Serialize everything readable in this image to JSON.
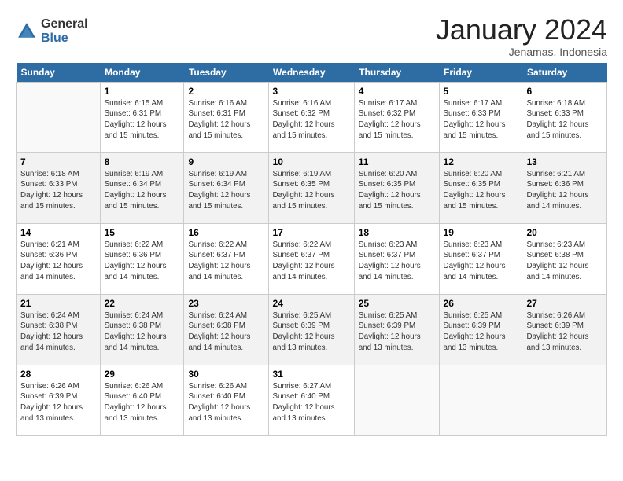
{
  "logo": {
    "general": "General",
    "blue": "Blue"
  },
  "title": "January 2024",
  "subtitle": "Jenamas, Indonesia",
  "header_days": [
    "Sunday",
    "Monday",
    "Tuesday",
    "Wednesday",
    "Thursday",
    "Friday",
    "Saturday"
  ],
  "weeks": [
    [
      {
        "num": "",
        "info": ""
      },
      {
        "num": "1",
        "info": "Sunrise: 6:15 AM\nSunset: 6:31 PM\nDaylight: 12 hours\nand 15 minutes."
      },
      {
        "num": "2",
        "info": "Sunrise: 6:16 AM\nSunset: 6:31 PM\nDaylight: 12 hours\nand 15 minutes."
      },
      {
        "num": "3",
        "info": "Sunrise: 6:16 AM\nSunset: 6:32 PM\nDaylight: 12 hours\nand 15 minutes."
      },
      {
        "num": "4",
        "info": "Sunrise: 6:17 AM\nSunset: 6:32 PM\nDaylight: 12 hours\nand 15 minutes."
      },
      {
        "num": "5",
        "info": "Sunrise: 6:17 AM\nSunset: 6:33 PM\nDaylight: 12 hours\nand 15 minutes."
      },
      {
        "num": "6",
        "info": "Sunrise: 6:18 AM\nSunset: 6:33 PM\nDaylight: 12 hours\nand 15 minutes."
      }
    ],
    [
      {
        "num": "7",
        "info": "Sunrise: 6:18 AM\nSunset: 6:33 PM\nDaylight: 12 hours\nand 15 minutes."
      },
      {
        "num": "8",
        "info": "Sunrise: 6:19 AM\nSunset: 6:34 PM\nDaylight: 12 hours\nand 15 minutes."
      },
      {
        "num": "9",
        "info": "Sunrise: 6:19 AM\nSunset: 6:34 PM\nDaylight: 12 hours\nand 15 minutes."
      },
      {
        "num": "10",
        "info": "Sunrise: 6:19 AM\nSunset: 6:35 PM\nDaylight: 12 hours\nand 15 minutes."
      },
      {
        "num": "11",
        "info": "Sunrise: 6:20 AM\nSunset: 6:35 PM\nDaylight: 12 hours\nand 15 minutes."
      },
      {
        "num": "12",
        "info": "Sunrise: 6:20 AM\nSunset: 6:35 PM\nDaylight: 12 hours\nand 15 minutes."
      },
      {
        "num": "13",
        "info": "Sunrise: 6:21 AM\nSunset: 6:36 PM\nDaylight: 12 hours\nand 14 minutes."
      }
    ],
    [
      {
        "num": "14",
        "info": "Sunrise: 6:21 AM\nSunset: 6:36 PM\nDaylight: 12 hours\nand 14 minutes."
      },
      {
        "num": "15",
        "info": "Sunrise: 6:22 AM\nSunset: 6:36 PM\nDaylight: 12 hours\nand 14 minutes."
      },
      {
        "num": "16",
        "info": "Sunrise: 6:22 AM\nSunset: 6:37 PM\nDaylight: 12 hours\nand 14 minutes."
      },
      {
        "num": "17",
        "info": "Sunrise: 6:22 AM\nSunset: 6:37 PM\nDaylight: 12 hours\nand 14 minutes."
      },
      {
        "num": "18",
        "info": "Sunrise: 6:23 AM\nSunset: 6:37 PM\nDaylight: 12 hours\nand 14 minutes."
      },
      {
        "num": "19",
        "info": "Sunrise: 6:23 AM\nSunset: 6:37 PM\nDaylight: 12 hours\nand 14 minutes."
      },
      {
        "num": "20",
        "info": "Sunrise: 6:23 AM\nSunset: 6:38 PM\nDaylight: 12 hours\nand 14 minutes."
      }
    ],
    [
      {
        "num": "21",
        "info": "Sunrise: 6:24 AM\nSunset: 6:38 PM\nDaylight: 12 hours\nand 14 minutes."
      },
      {
        "num": "22",
        "info": "Sunrise: 6:24 AM\nSunset: 6:38 PM\nDaylight: 12 hours\nand 14 minutes."
      },
      {
        "num": "23",
        "info": "Sunrise: 6:24 AM\nSunset: 6:38 PM\nDaylight: 12 hours\nand 14 minutes."
      },
      {
        "num": "24",
        "info": "Sunrise: 6:25 AM\nSunset: 6:39 PM\nDaylight: 12 hours\nand 13 minutes."
      },
      {
        "num": "25",
        "info": "Sunrise: 6:25 AM\nSunset: 6:39 PM\nDaylight: 12 hours\nand 13 minutes."
      },
      {
        "num": "26",
        "info": "Sunrise: 6:25 AM\nSunset: 6:39 PM\nDaylight: 12 hours\nand 13 minutes."
      },
      {
        "num": "27",
        "info": "Sunrise: 6:26 AM\nSunset: 6:39 PM\nDaylight: 12 hours\nand 13 minutes."
      }
    ],
    [
      {
        "num": "28",
        "info": "Sunrise: 6:26 AM\nSunset: 6:39 PM\nDaylight: 12 hours\nand 13 minutes."
      },
      {
        "num": "29",
        "info": "Sunrise: 6:26 AM\nSunset: 6:40 PM\nDaylight: 12 hours\nand 13 minutes."
      },
      {
        "num": "30",
        "info": "Sunrise: 6:26 AM\nSunset: 6:40 PM\nDaylight: 12 hours\nand 13 minutes."
      },
      {
        "num": "31",
        "info": "Sunrise: 6:27 AM\nSunset: 6:40 PM\nDaylight: 12 hours\nand 13 minutes."
      },
      {
        "num": "",
        "info": ""
      },
      {
        "num": "",
        "info": ""
      },
      {
        "num": "",
        "info": ""
      }
    ]
  ]
}
